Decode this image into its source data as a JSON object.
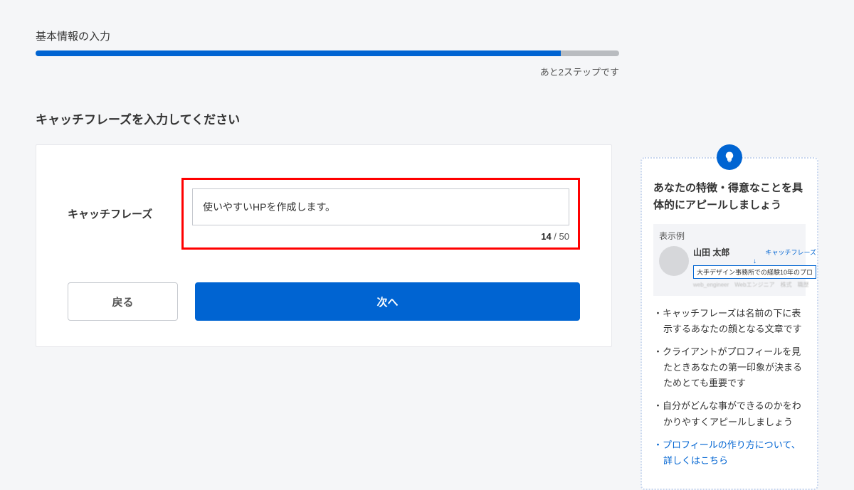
{
  "progress": {
    "title": "基本情報の入力",
    "caption": "あと2ステップです",
    "percent": 90
  },
  "section_title": "キャッチフレーズを入力してください",
  "field": {
    "label": "キャッチフレーズ",
    "value": "使いやすいHPを作成します。",
    "count_current": "14",
    "count_sep": " / ",
    "count_max": "50"
  },
  "buttons": {
    "back": "戻る",
    "next": "次へ"
  },
  "tip": {
    "title": "あなたの特徴・得意なことを具体的にアピールしましょう",
    "example_label": "表示例",
    "example_name": "山田 太郎",
    "example_catch_label": "キャッチフレーズ",
    "example_phrase": "大手デザイン事務所での経験10年のプロ",
    "example_tags": "web_engineer　Webエンジニア　株式　職歴",
    "bullets": [
      "・キャッチフレーズは名前の下に表示するあなたの顔となる文章です",
      "・クライアントがプロフィールを見たときあなたの第一印象が決まるためとても重要です",
      "・自分がどんな事ができるのかをわかりやすくアピールしましょう",
      "・プロフィールの作り方について、詳しくはこちら"
    ]
  }
}
